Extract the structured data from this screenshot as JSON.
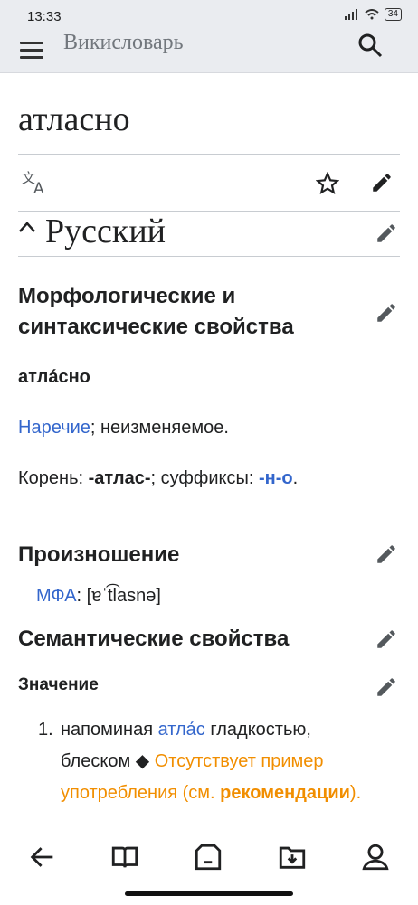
{
  "status": {
    "time": "13:33",
    "battery": "34"
  },
  "header": {
    "title": "Викисловарь"
  },
  "page": {
    "title": "атласно"
  },
  "sections": {
    "russian": "Русский",
    "morph_line1": "Морфологические и",
    "morph_line2": "синтаксические свойства",
    "word": "атла́сно",
    "pos_link": "Наречие",
    "pos_rest": "; неизменяемое.",
    "root_prefix": "Корень: ",
    "root": "-атлас-",
    "suffix_text": "; суффиксы: ",
    "suffix": "-н-о",
    "root_end": ".",
    "pron_title": "Произношение",
    "ipa_link": "МФА",
    "ipa_value": ": [ɐˈt͡lasnə]",
    "semantic_title": "Семантические свойства",
    "meaning_title": "Значение",
    "meaning_num": "1.",
    "meaning_a": "напоминая ",
    "meaning_link": "атла́с",
    "meaning_b": " гладкостью,",
    "meaning_c": "блеском ◆ ",
    "meaning_orange1": "Отсутствует пример",
    "meaning_orange2": "употребления (см. ",
    "meaning_orange_bold": "рекомендации",
    "meaning_orange_end": ")."
  }
}
